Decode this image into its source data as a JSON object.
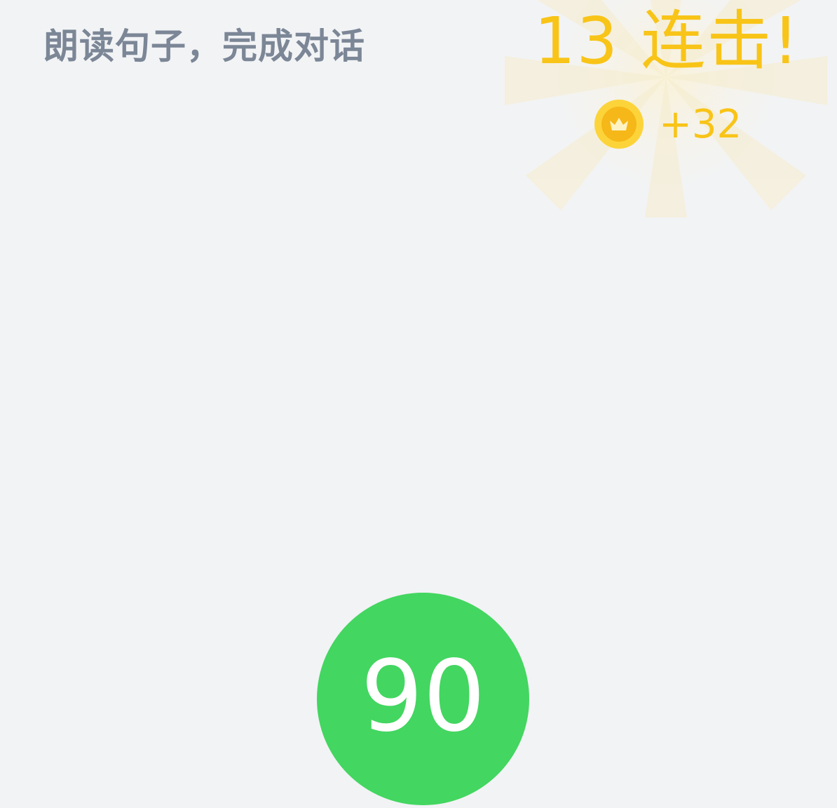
{
  "instruction": "朗读句子，完成对话",
  "combo": {
    "text": "13 连击!",
    "color": "#f8c417"
  },
  "reward": {
    "icon": "crown-coin-icon",
    "text": "+32"
  },
  "score": {
    "value": "90",
    "color": "#43d660"
  },
  "colors": {
    "background": "#f2f3f5",
    "instruction_text": "#7b8696",
    "coin_outer": "#fcd43a",
    "coin_inner": "#f6b718"
  }
}
